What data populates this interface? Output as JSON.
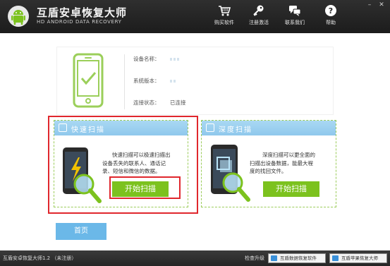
{
  "app": {
    "title": "互盾安卓恢复大师",
    "subtitle": "HD ANDROID DATA RECOVERY"
  },
  "header_buttons": [
    {
      "label": "购买软件",
      "icon": "cart-icon"
    },
    {
      "label": "注册激活",
      "icon": "key-icon"
    },
    {
      "label": "联系我们",
      "icon": "chat-icon"
    },
    {
      "label": "帮助",
      "icon": "help-icon"
    }
  ],
  "device": {
    "name_label": "设备名称：",
    "version_label": "系统版本：",
    "status_label": "连接状态：",
    "status_value": "已连接"
  },
  "quick_scan": {
    "title": "快速扫描",
    "description": [
      "快速扫描可以极速扫描出",
      "设备丢失的联系人、通话记",
      "录、短信和微信的数据。"
    ],
    "button": "开始扫描"
  },
  "deep_scan": {
    "title": "深度扫描",
    "description": [
      "深度扫描可以更全面的",
      "扫描出设备数据，能最大程",
      "度的找回文件。"
    ],
    "button": "开始扫描"
  },
  "home_button": "首页",
  "footer": {
    "version_text": "互盾安卓恢复大师1.2 （未注册）",
    "check_update": "检查升级",
    "btn_data_recovery": "互盾数据恢复软件",
    "btn_apple_recovery": "互盾苹果恢复大师"
  },
  "colors": {
    "header_bg": "#262626",
    "accent_green": "#7cc21e",
    "accent_blue": "#8fc8ec",
    "highlight_red": "#e0272d"
  }
}
